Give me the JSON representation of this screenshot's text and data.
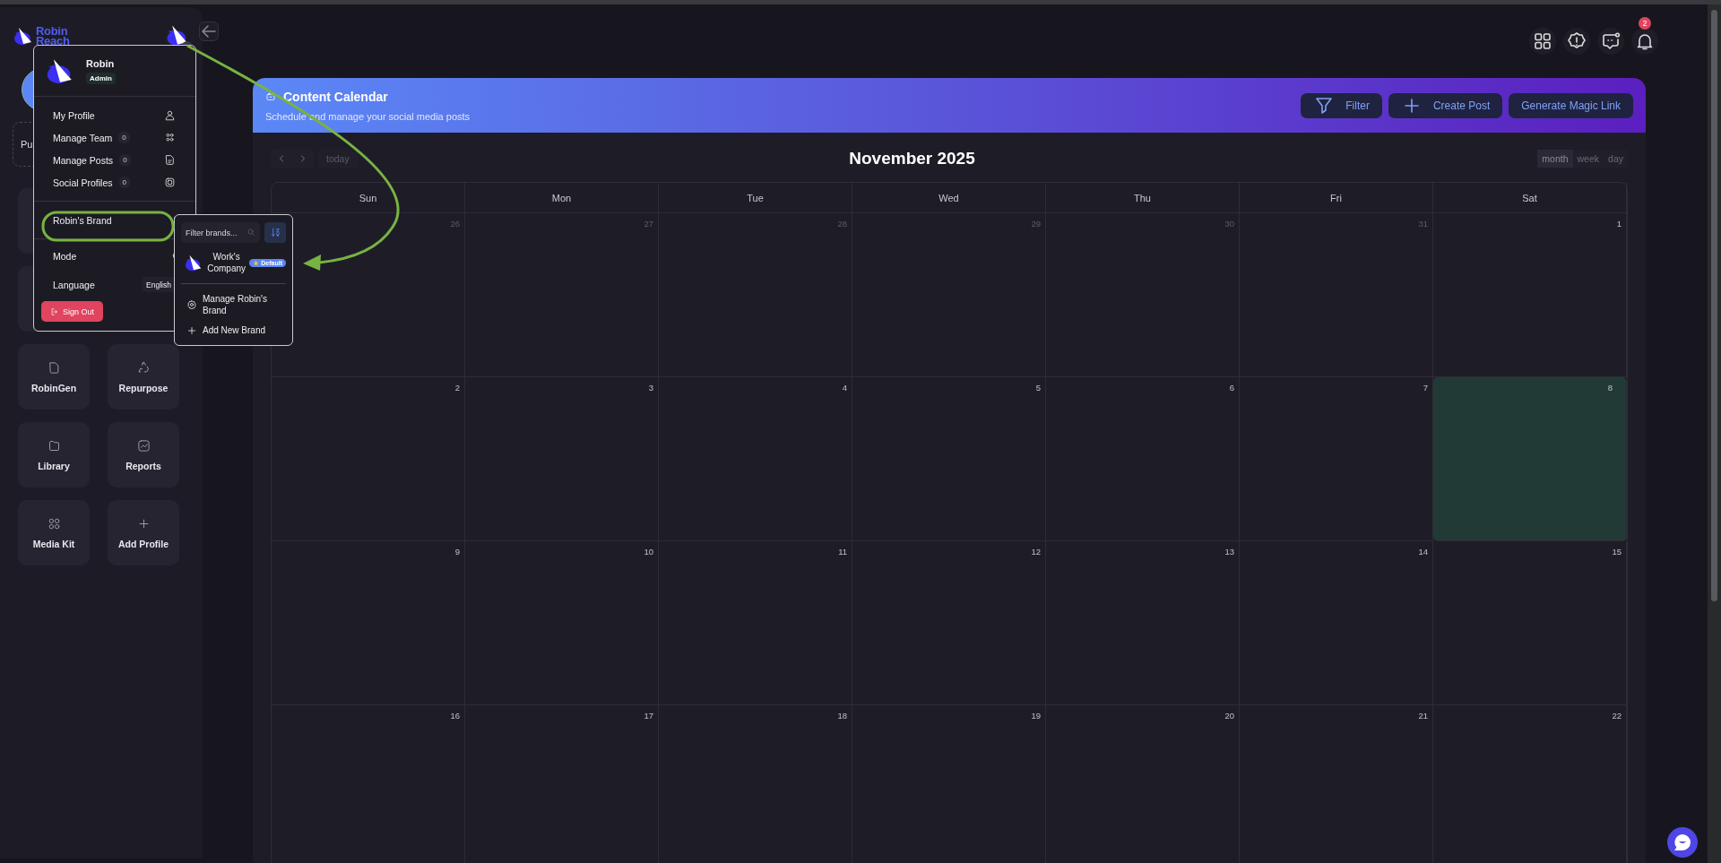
{
  "sidebar": {
    "logo": {
      "line_1": "Robin",
      "line_2": "Reach"
    },
    "partial_label": "Pu",
    "tiles": [
      {
        "label": "RobinGen"
      },
      {
        "label": "Repurpose"
      },
      {
        "label": "Library"
      },
      {
        "label": "Reports"
      },
      {
        "label": "Media Kit"
      },
      {
        "label": "Add Profile"
      }
    ]
  },
  "account_menu": {
    "name": "Robin",
    "role": "Admin",
    "items": [
      {
        "label": "My Profile"
      },
      {
        "label": "Manage Team",
        "count": "0"
      },
      {
        "label": "Manage Posts",
        "count": "0"
      },
      {
        "label": "Social Profiles",
        "count": "0"
      }
    ],
    "brand": "Robin's Brand",
    "mode_label": "Mode",
    "language": {
      "label": "Language",
      "value": "English"
    },
    "sign_out": "Sign Out"
  },
  "brand_menu": {
    "filter_placeholder": "Filter brands...",
    "brands": [
      {
        "name": "Work's Company",
        "badge": "Default"
      }
    ],
    "actions": [
      {
        "label": "Manage Robin's Brand"
      },
      {
        "label": "Add New Brand"
      }
    ]
  },
  "top_bar": {
    "notification_count": "2"
  },
  "header": {
    "title": "Content Calendar",
    "subtitle": "Schedule and manage your social media posts",
    "buttons": [
      {
        "label": "Filter"
      },
      {
        "label": "Create Post"
      },
      {
        "label": "Generate Magic Link"
      }
    ]
  },
  "calendar": {
    "today_button": "today",
    "title": "November 2025",
    "views": [
      {
        "label": "month",
        "selected": true
      },
      {
        "label": "week",
        "selected": false
      },
      {
        "label": "day",
        "selected": false
      }
    ],
    "weekdays": [
      "Sun",
      "Mon",
      "Tue",
      "Wed",
      "Thu",
      "Fri",
      "Sat"
    ],
    "weeks": [
      [
        {
          "day": "26",
          "outside": true,
          "today": false
        },
        {
          "day": "27",
          "outside": true,
          "today": false
        },
        {
          "day": "28",
          "outside": true,
          "today": false
        },
        {
          "day": "29",
          "outside": true,
          "today": false
        },
        {
          "day": "30",
          "outside": true,
          "today": false
        },
        {
          "day": "31",
          "outside": true,
          "today": false
        },
        {
          "day": "1",
          "outside": false,
          "today": false
        }
      ],
      [
        {
          "day": "2",
          "outside": false,
          "today": false
        },
        {
          "day": "3",
          "outside": false,
          "today": false
        },
        {
          "day": "4",
          "outside": false,
          "today": false
        },
        {
          "day": "5",
          "outside": false,
          "today": false
        },
        {
          "day": "6",
          "outside": false,
          "today": false
        },
        {
          "day": "7",
          "outside": false,
          "today": false
        },
        {
          "day": "8",
          "outside": false,
          "today": true
        }
      ],
      [
        {
          "day": "9",
          "outside": false,
          "today": false
        },
        {
          "day": "10",
          "outside": false,
          "today": false
        },
        {
          "day": "11",
          "outside": false,
          "today": false
        },
        {
          "day": "12",
          "outside": false,
          "today": false
        },
        {
          "day": "13",
          "outside": false,
          "today": false
        },
        {
          "day": "14",
          "outside": false,
          "today": false
        },
        {
          "day": "15",
          "outside": false,
          "today": false
        }
      ],
      [
        {
          "day": "16",
          "outside": false,
          "today": false
        },
        {
          "day": "17",
          "outside": false,
          "today": false
        },
        {
          "day": "18",
          "outside": false,
          "today": false
        },
        {
          "day": "19",
          "outside": false,
          "today": false
        },
        {
          "day": "20",
          "outside": false,
          "today": false
        },
        {
          "day": "21",
          "outside": false,
          "today": false
        },
        {
          "day": "22",
          "outside": false,
          "today": false
        }
      ]
    ]
  }
}
